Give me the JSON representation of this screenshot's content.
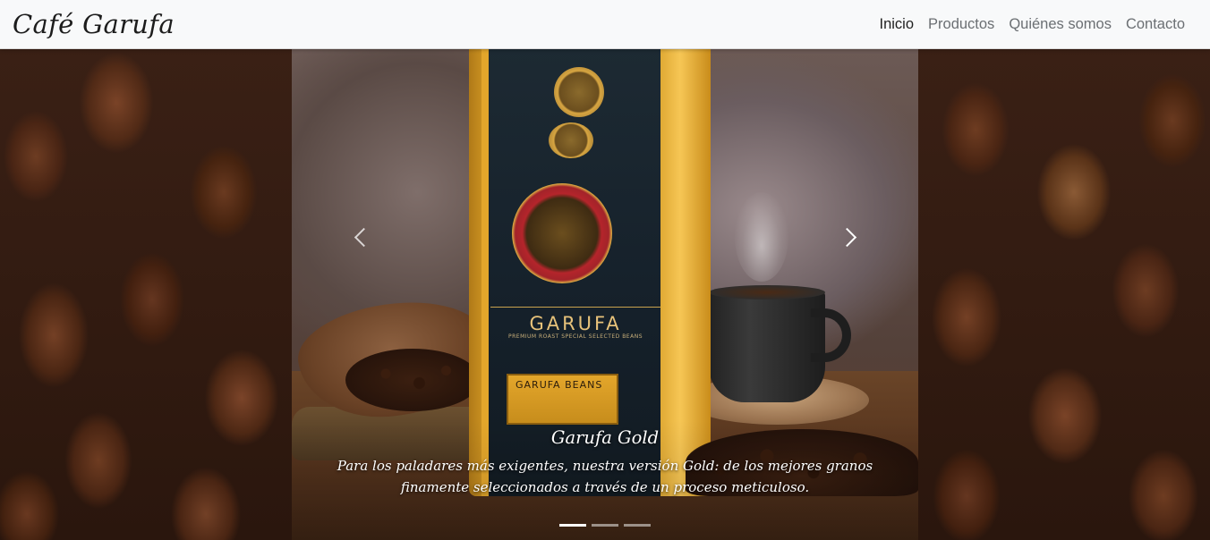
{
  "navbar": {
    "brand": "Café Garufa",
    "links": [
      {
        "label": "Inicio",
        "active": true
      },
      {
        "label": "Productos",
        "active": false
      },
      {
        "label": "Quiénes somos",
        "active": false
      },
      {
        "label": "Contacto",
        "active": false
      }
    ]
  },
  "carousel": {
    "slide": {
      "title": "Garufa Gold",
      "text": "Para los paladares más exigentes, nuestra versión Gold: de los mejores granos finamente seleccionados a través de un proceso meticuloso."
    },
    "product_image_text": {
      "bag_title": "GARUFA",
      "bag_subtitle": "PREMIUM ROAST SPECIAL SELECTED BEANS",
      "bag_label": "GARUFA BEANS"
    },
    "controls": {
      "prev_icon": "chevron-left-icon",
      "next_icon": "chevron-right-icon"
    },
    "indicators": [
      {
        "active": true
      },
      {
        "active": false
      },
      {
        "active": false
      }
    ]
  },
  "colors": {
    "navbar_bg": "#f8f9fa",
    "nav_active": "#1f1f1f",
    "nav_inactive": "#6b6f73",
    "caption_text": "#ffffff"
  }
}
